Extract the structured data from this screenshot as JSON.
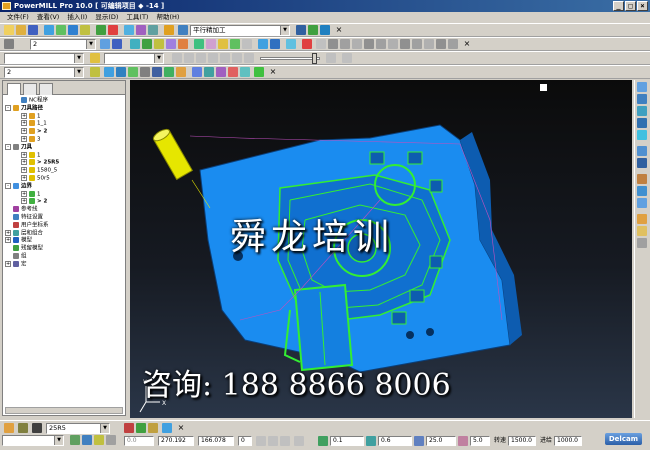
{
  "window": {
    "title": "PowerMILL Pro 10.0   [ 可编辑项目 ◆ -14 ]"
  },
  "menu": [
    "文件(F)",
    "查看(V)",
    "插入(I)",
    "显示(D)",
    "工具(T)",
    "帮助(H)"
  ],
  "toolbar1": {
    "strategy_combo": "平行精加工"
  },
  "toolbar2": {
    "combo_value": "2"
  },
  "toolbar4": {
    "combo_value": "2"
  },
  "tree": [
    {
      "label": "NC程序",
      "indent": 1,
      "exp": "",
      "bold": false,
      "color": "#4080c0"
    },
    {
      "label": "刀具路径",
      "indent": 0,
      "exp": "-",
      "bold": true,
      "color": "#e0a020"
    },
    {
      "label": "1",
      "indent": 2,
      "exp": "+",
      "bold": false,
      "color": "#e0a020"
    },
    {
      "label": "1_1",
      "indent": 2,
      "exp": "+",
      "bold": false,
      "color": "#e0a020"
    },
    {
      "label": "> 2",
      "indent": 2,
      "exp": "+",
      "bold": true,
      "color": "#e0a020"
    },
    {
      "label": "3",
      "indent": 2,
      "exp": "+",
      "bold": false,
      "color": "#e0a020"
    },
    {
      "label": "刀具",
      "indent": 0,
      "exp": "-",
      "bold": true,
      "color": "#808080"
    },
    {
      "label": "1",
      "indent": 2,
      "exp": "+",
      "bold": false,
      "color": "#e0c000"
    },
    {
      "label": "> 25R5",
      "indent": 2,
      "exp": "+",
      "bold": true,
      "color": "#e0c000"
    },
    {
      "label": "1580_5",
      "indent": 2,
      "exp": "+",
      "bold": false,
      "color": "#e0c000"
    },
    {
      "label": "50r5",
      "indent": 2,
      "exp": "+",
      "bold": false,
      "color": "#e0c000"
    },
    {
      "label": "边界",
      "indent": 0,
      "exp": "-",
      "bold": true,
      "color": "#4090e0"
    },
    {
      "label": "1",
      "indent": 2,
      "exp": "+",
      "bold": false,
      "color": "#40b040"
    },
    {
      "label": "> 2",
      "indent": 2,
      "exp": "+",
      "bold": true,
      "color": "#40b040"
    },
    {
      "label": "参考线",
      "indent": 0,
      "exp": "",
      "bold": false,
      "color": "#a040a0"
    },
    {
      "label": "特征设置",
      "indent": 0,
      "exp": "",
      "bold": false,
      "color": "#4080c0"
    },
    {
      "label": "用户坐标系",
      "indent": 0,
      "exp": "",
      "bold": false,
      "color": "#c04040"
    },
    {
      "label": "层和组合",
      "indent": 0,
      "exp": "+",
      "bold": false,
      "color": "#40a0a0"
    },
    {
      "label": "模型",
      "indent": 0,
      "exp": "+",
      "bold": false,
      "color": "#2060c0"
    },
    {
      "label": "残留模型",
      "indent": 0,
      "exp": "",
      "bold": false,
      "color": "#40a040"
    },
    {
      "label": "组",
      "indent": 0,
      "exp": "",
      "bold": false,
      "color": "#808080"
    },
    {
      "label": "宏",
      "indent": 0,
      "exp": "+",
      "bold": false,
      "color": "#6060a0"
    }
  ],
  "watermark": {
    "main": "舜龙培训",
    "contact": "咨询: 188 8866 8006"
  },
  "status": {
    "tool_combo": "25R5",
    "field_a": "0.0",
    "coord_x": "270.192",
    "coord_y": "166.078",
    "coord_z": "0",
    "tolerance": "0.1",
    "thickness": "0.6",
    "stepover": "25.0",
    "step": "5.0",
    "spindle_label": "转速",
    "spindle": "1500.0",
    "feed_label": "进给",
    "feed": "1000.0",
    "brand": "Delcam"
  },
  "colors": {
    "model_blue": "#1a8cf0",
    "toolpath_green": "#33ee33",
    "tool_yellow": "#e6e600"
  }
}
